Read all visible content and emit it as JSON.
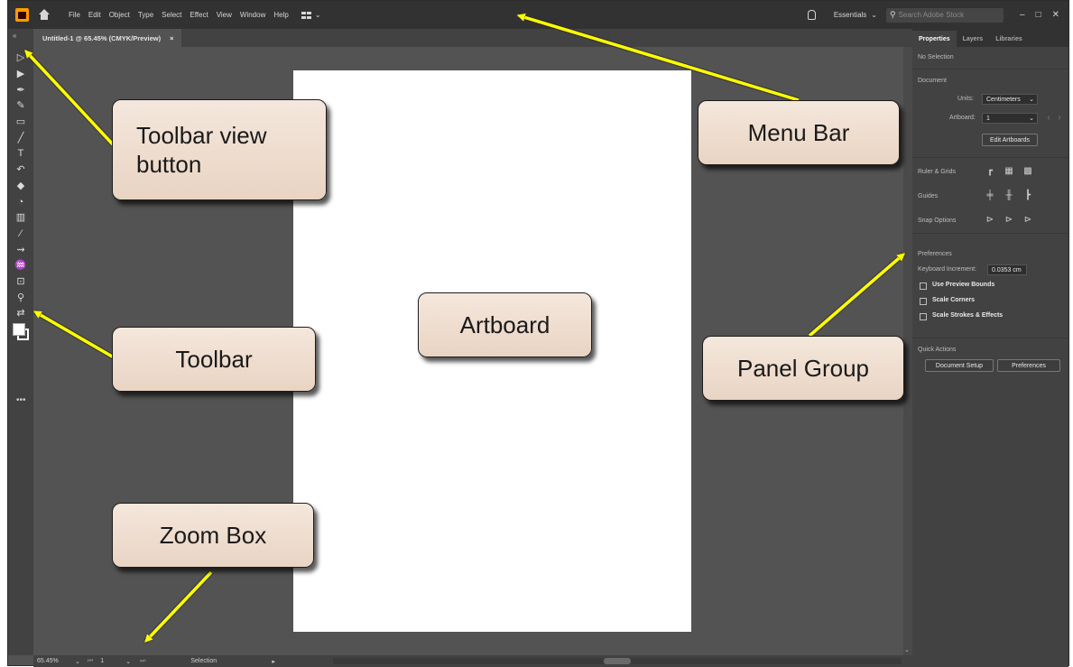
{
  "app": {
    "menu": [
      "File",
      "Edit",
      "Object",
      "Type",
      "Select",
      "Effect",
      "View",
      "Window",
      "Help"
    ],
    "workspace": "Essentials",
    "stock_search_placeholder": "Search Adobe Stock",
    "window_controls": [
      "–",
      "□",
      "✕"
    ]
  },
  "document_tab": {
    "title": "Untitled-1 @ 65.45% (CMYK/Preview)",
    "close": "×"
  },
  "toolbar": {
    "collapse_glyph": "«",
    "tools": [
      {
        "name": "selection-tool",
        "glyph": "▷"
      },
      {
        "name": "direct-selection-tool",
        "glyph": "▶"
      },
      {
        "name": "pen-tool",
        "glyph": "✒"
      },
      {
        "name": "curvature-tool",
        "glyph": "✎"
      },
      {
        "name": "rectangle-tool",
        "glyph": "▭"
      },
      {
        "name": "paintbrush-tool",
        "glyph": "╱"
      },
      {
        "name": "type-tool",
        "glyph": "T"
      },
      {
        "name": "rotate-tool",
        "glyph": "↶"
      },
      {
        "name": "eraser-tool",
        "glyph": "◆"
      },
      {
        "name": "shape-builder-tool",
        "glyph": "◔"
      },
      {
        "name": "gradient-tool",
        "glyph": "▥"
      },
      {
        "name": "eyedropper-tool",
        "glyph": "⁄"
      },
      {
        "name": "blend-tool",
        "glyph": "⇝"
      },
      {
        "name": "symbol-sprayer-tool",
        "glyph": "♒"
      },
      {
        "name": "artboard-tool",
        "glyph": "⊡"
      },
      {
        "name": "zoom-tool",
        "glyph": "⚲"
      },
      {
        "name": "swap-fill-stroke",
        "glyph": "⇄"
      }
    ],
    "more_glyph": "•••"
  },
  "panel": {
    "tabs": [
      "Properties",
      "Layers",
      "Libraries"
    ],
    "no_selection": "No Selection",
    "document_heading": "Document",
    "units_label": "Units:",
    "units_value": "Centimeters",
    "artboard_label": "Artboard:",
    "artboard_value": "1",
    "edit_artboards": "Edit Artboards",
    "rulers_grids": "Ruler & Grids",
    "guides": "Guides",
    "snap_options": "Snap Options",
    "preferences_heading": "Preferences",
    "keyboard_increment_label": "Keyboard Increment:",
    "keyboard_increment_value": "0.0353 cm",
    "use_preview_bounds": "Use Preview Bounds",
    "scale_corners": "Scale Corners",
    "scale_strokes": "Scale Strokes & Effects",
    "quick_actions": "Quick Actions",
    "document_setup": "Document Setup",
    "preferences_button": "Preferences"
  },
  "statusbar": {
    "zoom": "65.45%",
    "artboard_number": "1",
    "status_text": "Selection"
  },
  "callouts": {
    "toolbar_view_button": "Toolbar view button",
    "menu_bar": "Menu Bar",
    "artboard": "Artboard",
    "toolbar": "Toolbar",
    "panel_group": "Panel Group",
    "zoom_box": "Zoom Box"
  },
  "colors": {
    "callout_fill": "#efdfd2",
    "arrow": "#ffff00",
    "app_background": "#535353",
    "menubar": "#323232",
    "logo_orange": "#ff9a00"
  }
}
